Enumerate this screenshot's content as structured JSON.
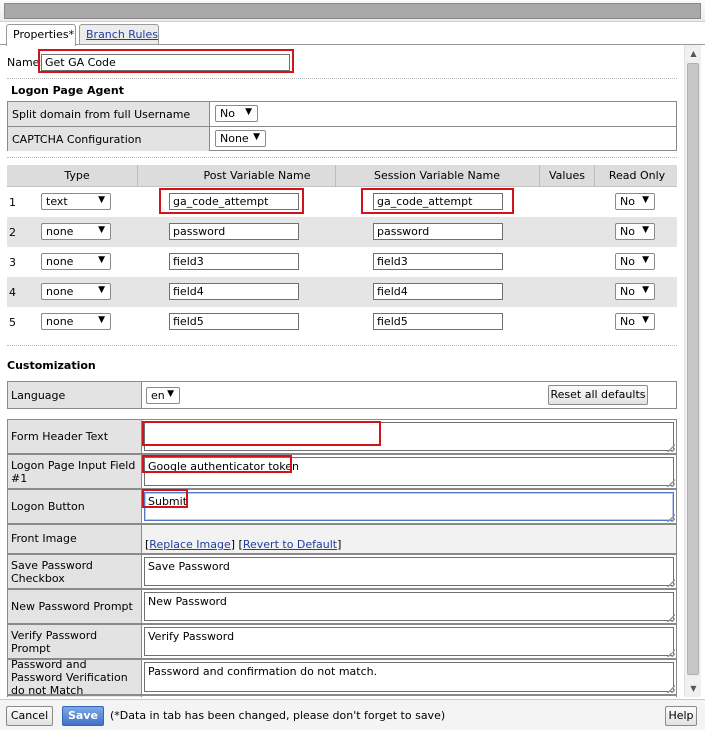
{
  "tabs": [
    {
      "label": "Properties*",
      "active": true
    },
    {
      "label": "Branch Rules",
      "active": false
    }
  ],
  "name_field": {
    "label": "Name:",
    "value": "Get GA Code"
  },
  "logon_page_agent": {
    "title": "Logon Page Agent",
    "rows": [
      {
        "label": "Split domain from full Username",
        "value": "No"
      },
      {
        "label": "CAPTCHA Configuration",
        "value": "None"
      }
    ]
  },
  "variables_table": {
    "headers": {
      "type": "Type",
      "post": "Post Variable Name",
      "session": "Session Variable Name",
      "values": "Values",
      "readonly": "Read Only"
    },
    "rows": [
      {
        "num": "1",
        "type": "text",
        "post": "ga_code_attempt",
        "session": "ga_code_attempt",
        "readonly": "No"
      },
      {
        "num": "2",
        "type": "none",
        "post": "password",
        "session": "password",
        "readonly": "No"
      },
      {
        "num": "3",
        "type": "none",
        "post": "field3",
        "session": "field3",
        "readonly": "No"
      },
      {
        "num": "4",
        "type": "none",
        "post": "field4",
        "session": "field4",
        "readonly": "No"
      },
      {
        "num": "5",
        "type": "none",
        "post": "field5",
        "session": "field5",
        "readonly": "No"
      }
    ]
  },
  "customization": {
    "title": "Customization",
    "language_label": "Language",
    "language_value": "en",
    "reset_button": "Reset all defaults",
    "form_header_label": "Form Header Text",
    "form_header_value": "",
    "input_field_label": "Logon Page Input Field #1",
    "input_field_value": "Google authenticator token",
    "logon_button_label": "Logon Button",
    "logon_button_value": "Submit",
    "front_image_label": "Front Image",
    "replace_image": "Replace Image",
    "revert_default": "Revert to Default",
    "save_password_label": "Save Password Checkbox",
    "save_password_value": "Save Password",
    "new_password_label": "New Password Prompt",
    "new_password_value": "New Password",
    "verify_password_label": "Verify Password Prompt",
    "verify_password_value": "Verify Password",
    "mismatch_label": "Password and Password Verification do not Match",
    "mismatch_value": "Password and confirmation do not match."
  },
  "footer": {
    "cancel": "Cancel",
    "save": "Save",
    "note": "(*Data in tab has been changed, please don't forget to save)",
    "help": "Help"
  },
  "colors": {
    "highlight": "#d0141a",
    "primary_button": "#3f72c7"
  }
}
